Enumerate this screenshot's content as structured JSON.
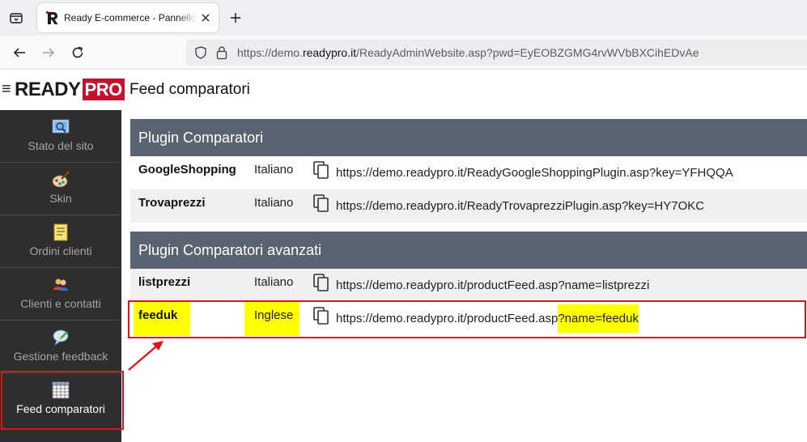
{
  "browser": {
    "tab_title": "Ready E-commerce - Pannello di controllo",
    "url_prefix": "https://demo.",
    "url_domain": "readypro.it",
    "url_suffix": "/ReadyAdminWebsite.asp?pwd=EyEOBZGMG4rvWVbBXCihEDvAe"
  },
  "header": {
    "logo_ready": "READY",
    "logo_pro": "PRO",
    "page_title": "Feed comparatori"
  },
  "sidebar": {
    "items": [
      {
        "label": "Stato del sito",
        "icon": "site-status-icon"
      },
      {
        "label": "Skin",
        "icon": "palette-icon"
      },
      {
        "label": "Ordini clienti",
        "icon": "orders-icon"
      },
      {
        "label": "Clienti e contatti",
        "icon": "contacts-icon"
      },
      {
        "label": "Gestione feedback",
        "icon": "feedback-icon"
      },
      {
        "label": "Feed comparatori",
        "icon": "grid-icon",
        "active": true
      }
    ]
  },
  "sections": [
    {
      "title": "Plugin Comparatori",
      "rows": [
        {
          "name": "GoogleShopping",
          "lang": "Italiano",
          "url": "https://demo.readypro.it/ReadyGoogleShoppingPlugin.asp?key=YFHQQA"
        },
        {
          "name": "Trovaprezzi",
          "lang": "Italiano",
          "url": "https://demo.readypro.it/ReadyTrovaprezziPlugin.asp?key=HY7OKC"
        }
      ]
    },
    {
      "title": "Plugin Comparatori avanzati",
      "rows": [
        {
          "name": "listprezzi",
          "lang": "Italiano",
          "url": "https://demo.readypro.it/productFeed.asp?name=listprezzi"
        },
        {
          "name": "feeduk",
          "lang": "Inglese",
          "url_base": "https://demo.readypro.it/productFeed.asp",
          "url_param": "?name=feeduk"
        }
      ]
    }
  ],
  "colors": {
    "section_header": "#5a6370",
    "sidebar": "#2e2e2e",
    "highlight": "#ffff00",
    "annotation": "#e0101a",
    "logo_red": "#c8102e"
  }
}
